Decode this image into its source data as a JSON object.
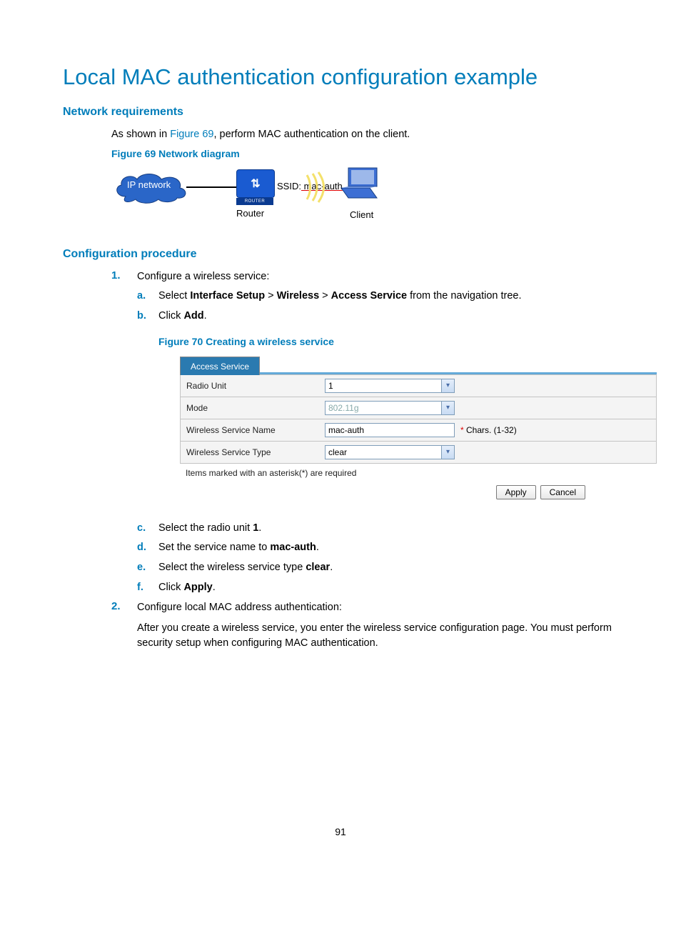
{
  "title": "Local MAC authentication configuration example",
  "sections": {
    "net_req": "Network requirements",
    "config_proc": "Configuration procedure"
  },
  "intro": {
    "prefix": "As shown in ",
    "link": "Figure 69",
    "suffix": ", perform MAC authentication on the client."
  },
  "fig69": {
    "caption": "Figure 69 Network diagram",
    "ip_network": "IP network",
    "router": "Router",
    "router_band": "ROUTER",
    "ssid": "SSID:",
    "ssid_val": " mac-auth",
    "client": "Client"
  },
  "proc": {
    "step1": {
      "num": "1.",
      "text": "Configure a wireless service:",
      "a_letter": "a.",
      "a_pre": "Select ",
      "a_b1": "Interface Setup",
      "a_sep1": " > ",
      "a_b2": "Wireless",
      "a_sep2": " > ",
      "a_b3": "Access Service",
      "a_post": " from the navigation tree.",
      "b_letter": "b.",
      "b_pre": "Click ",
      "b_b": "Add",
      "b_post": ".",
      "c_letter": "c.",
      "c_pre": "Select the radio unit ",
      "c_b": "1",
      "c_post": ".",
      "d_letter": "d.",
      "d_pre": "Set the service name to ",
      "d_b": "mac-auth",
      "d_post": ".",
      "e_letter": "e.",
      "e_pre": "Select the wireless service type ",
      "e_b": "clear",
      "e_post": ".",
      "f_letter": "f.",
      "f_pre": "Click ",
      "f_b": "Apply",
      "f_post": "."
    },
    "step2": {
      "num": "2.",
      "text": "Configure local MAC address authentication:",
      "para": "After you create a wireless service, you enter the wireless service configuration page. You must perform security setup when configuring MAC authentication."
    }
  },
  "fig70": {
    "caption": "Figure 70 Creating a wireless service",
    "tab": "Access Service",
    "rows": {
      "radio_label": "Radio Unit",
      "radio_value": "1",
      "mode_label": "Mode",
      "mode_value": "802.11g",
      "name_label": "Wireless Service Name",
      "name_value": "mac-auth",
      "name_hint": " Chars. (1-32)",
      "name_ast": "*",
      "type_label": "Wireless Service Type",
      "type_value": "clear"
    },
    "note": "Items marked with an asterisk(*) are required",
    "apply": "Apply",
    "cancel": "Cancel"
  },
  "dropdown_glyph": "▾",
  "router_glyph": "⇅",
  "page_number": "91"
}
